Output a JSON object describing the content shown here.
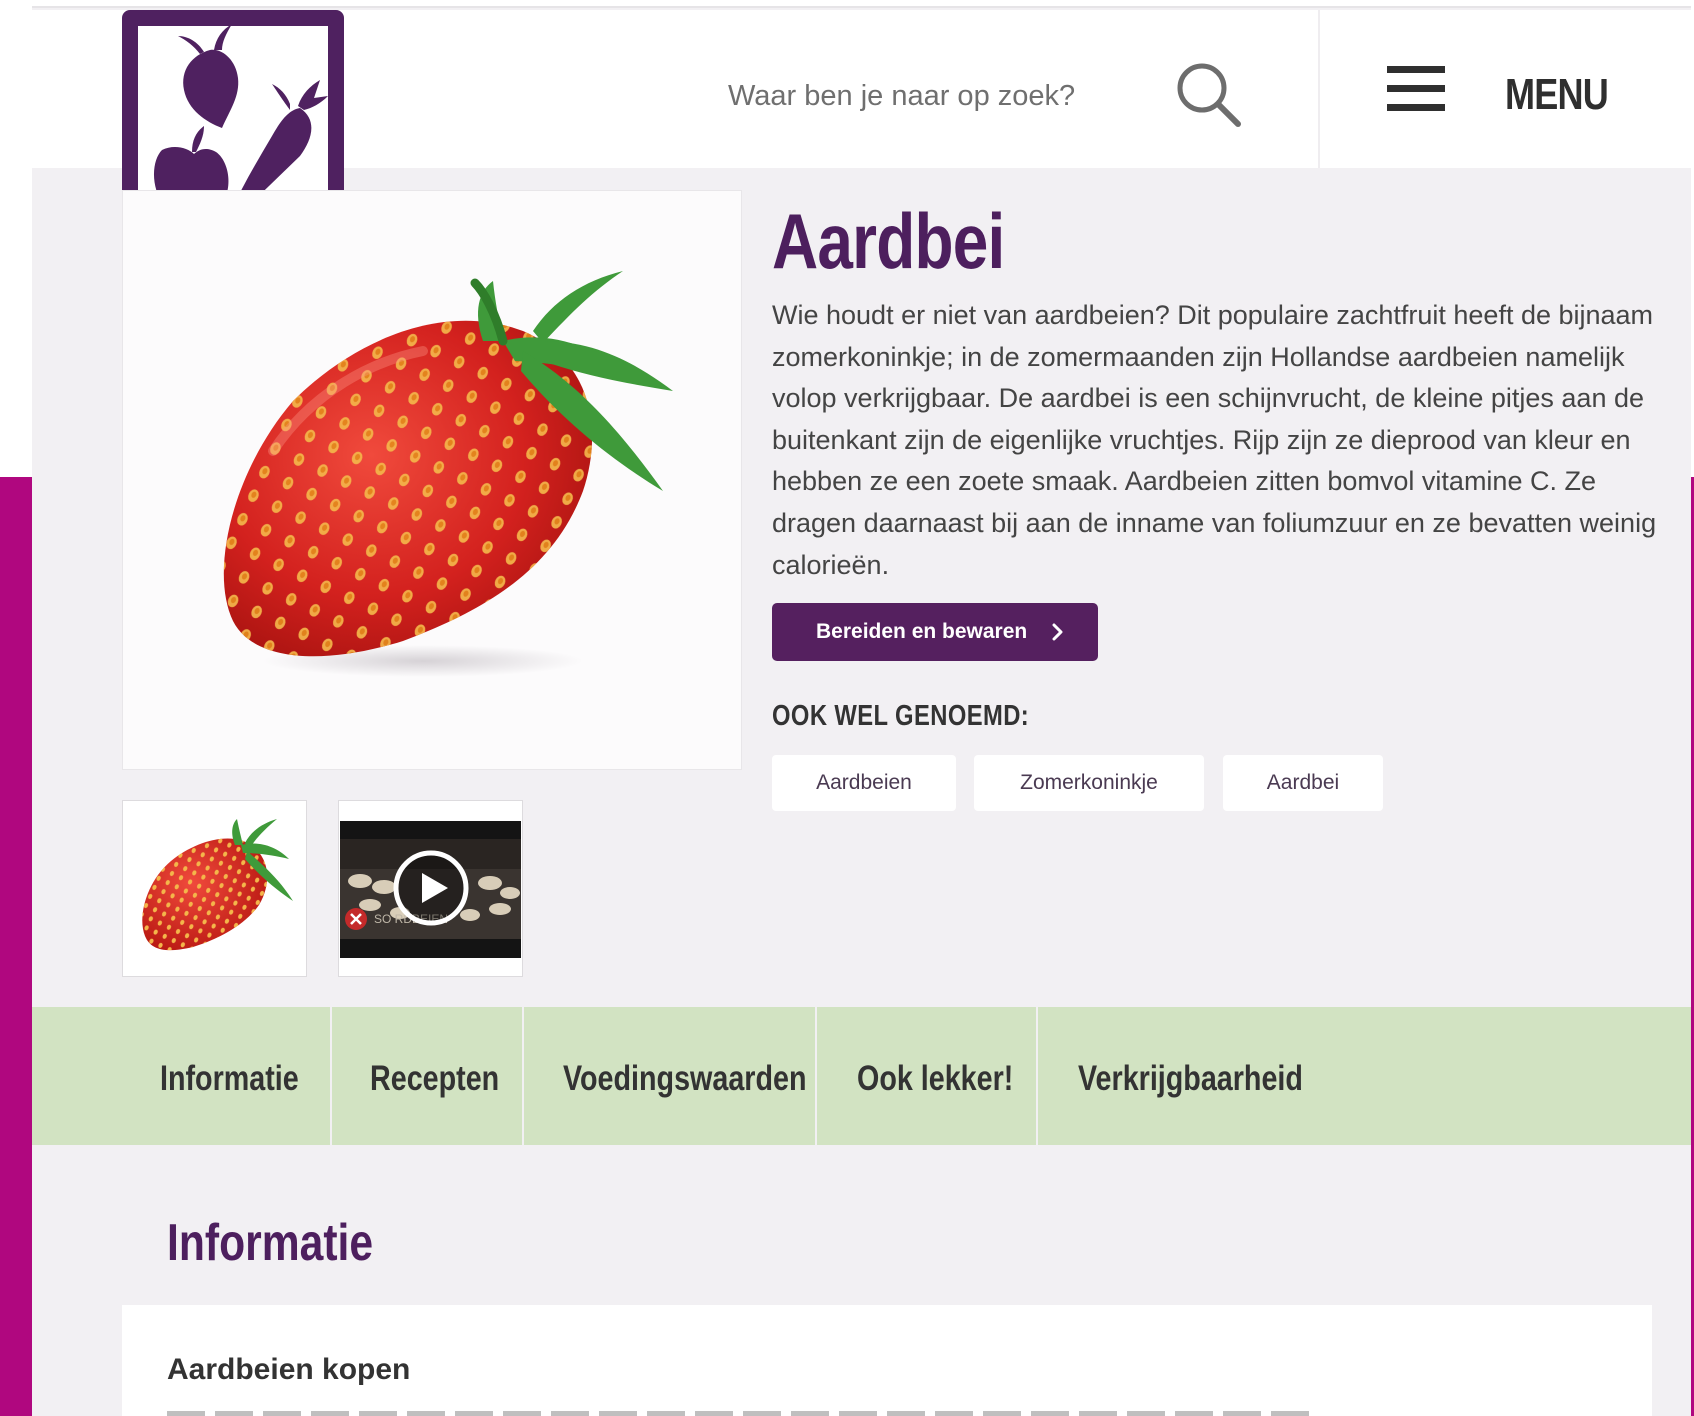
{
  "header": {
    "search_placeholder": "Waar ben je naar op zoek?",
    "menu_label": "MENU"
  },
  "product": {
    "title": "Aardbei",
    "description": "Wie houdt er niet van aardbeien? Dit populaire zachtfruit heeft de bijnaam zomerkoninkje; in de zomermaanden zijn Hollandse aardbeien namelijk volop verkrijgbaar. De aardbei is een schijnvrucht, de kleine pitjes aan de buitenkant zijn de eigenlijke vruchtjes. Rijp zijn ze dieprood van kleur en hebben ze een zoete smaak. Aardbeien zitten bomvol vitamine C. Ze dragen daarnaast bij aan de inname van foliumzuur en ze bevatten weinig calorieën.",
    "cta_label": "Bereiden en bewaren",
    "aka_heading": "OOK WEL GENOEMD:",
    "aka": [
      "Aardbeien",
      "Zomerkoninkje",
      "Aardbei"
    ]
  },
  "tabs": [
    "Informatie",
    "Recepten",
    "Voedingswaarden",
    "Ook lekker!",
    "Verkrijgbaarheid"
  ],
  "info": {
    "title": "Informatie",
    "subtitle": "Aardbeien kopen"
  },
  "colors": {
    "brand_purple": "#4d1f5e",
    "button_purple": "#55205f",
    "magenta": "#b0077f",
    "tab_green": "#d2e3c2",
    "background": "#f2f0f3"
  },
  "icons": {
    "search": "search-icon",
    "menu": "hamburger-icon",
    "cta": "chevron-right-icon",
    "video": "play-icon"
  }
}
